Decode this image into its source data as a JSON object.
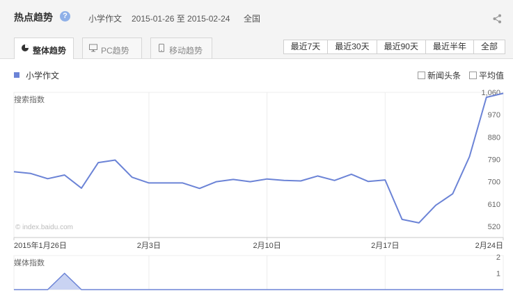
{
  "header": {
    "title": "热点趋势",
    "help_glyph": "?",
    "keyword": "小学作文",
    "date_range": "2015-01-26 至 2015-02-24",
    "region": "全国",
    "share_icon": "share-icon"
  },
  "tabs": [
    {
      "label": "整体趋势",
      "icon": "pie-icon",
      "active": true
    },
    {
      "label": "PC趋势",
      "icon": "monitor-icon",
      "active": false
    },
    {
      "label": "移动趋势",
      "icon": "phone-icon",
      "active": false
    }
  ],
  "ranges": [
    "最近7天",
    "最近30天",
    "最近90天",
    "最近半年",
    "全部"
  ],
  "legend": {
    "series": "小学作文",
    "color": "#6b83d6"
  },
  "toggles": {
    "news": "新闻头条",
    "avg": "平均值"
  },
  "chart_data": [
    {
      "type": "line",
      "ylabel": "搜索指数",
      "watermark": "© index.baidu.com",
      "x": [
        "2015-01-26",
        "2015-01-27",
        "2015-01-28",
        "2015-01-29",
        "2015-01-30",
        "2015-01-31",
        "2015-02-01",
        "2015-02-02",
        "2015-02-03",
        "2015-02-04",
        "2015-02-05",
        "2015-02-06",
        "2015-02-07",
        "2015-02-08",
        "2015-02-09",
        "2015-02-10",
        "2015-02-11",
        "2015-02-12",
        "2015-02-13",
        "2015-02-14",
        "2015-02-15",
        "2015-02-16",
        "2015-02-17",
        "2015-02-18",
        "2015-02-19",
        "2015-02-20",
        "2015-02-21",
        "2015-02-22",
        "2015-02-23",
        "2015-02-24"
      ],
      "xticks": [
        "2015年1月26日",
        "2月3日",
        "2月10日",
        "2月17日",
        "2月24日"
      ],
      "yticks": [
        "1,060",
        "970",
        "880",
        "790",
        "700",
        "610",
        "520"
      ],
      "ylim": [
        475,
        1060
      ],
      "values": [
        740,
        733,
        712,
        727,
        674,
        777,
        787,
        718,
        695,
        695,
        695,
        673,
        700,
        709,
        700,
        711,
        705,
        703,
        723,
        705,
        730,
        701,
        707,
        548,
        534,
        605,
        651,
        801,
        1040,
        1056
      ],
      "color": "#6b83d6"
    },
    {
      "type": "area",
      "ylabel": "媒体指数",
      "yticks": [
        "2",
        "1"
      ],
      "ylim": [
        0,
        2
      ],
      "values": [
        0,
        0,
        0,
        1,
        0,
        0,
        0,
        0,
        0,
        0,
        0,
        0,
        0,
        0,
        0,
        0,
        0,
        0,
        0,
        0,
        0,
        0,
        0,
        0,
        0,
        0,
        0,
        0,
        0,
        0
      ],
      "color": "#6b83d6"
    }
  ]
}
